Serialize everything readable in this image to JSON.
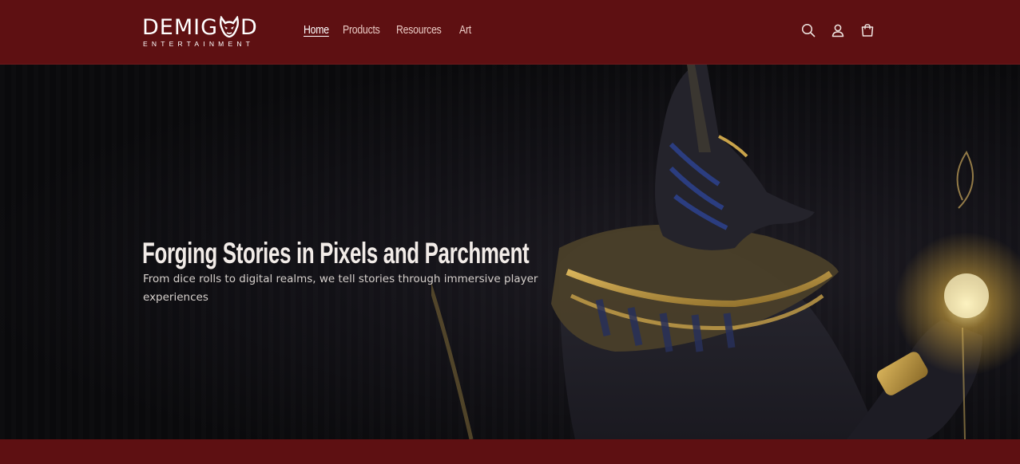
{
  "brand": {
    "name_prefix": "DEMIG",
    "name_suffix": "D",
    "tagline": "ENTERTAINMENT",
    "logo_icon": "demon-mask-icon"
  },
  "nav": {
    "items": [
      {
        "label": "Home",
        "active": true
      },
      {
        "label": "Products",
        "active": false
      },
      {
        "label": "Resources",
        "active": false
      },
      {
        "label": "Art",
        "active": false
      }
    ]
  },
  "header_icons": [
    "search-icon",
    "account-icon",
    "cart-icon"
  ],
  "hero": {
    "title": "Forging Stories in Pixels and Parchment",
    "subtitle": "From dice rolls to digital realms, we tell stories through immersive player experiences",
    "image": "anubis-illustration"
  },
  "colors": {
    "header_bg": "#5e1012",
    "hero_bg": "#0a0a0c",
    "accent_gold": "#c9a34a",
    "text_light": "#f2ece8"
  }
}
